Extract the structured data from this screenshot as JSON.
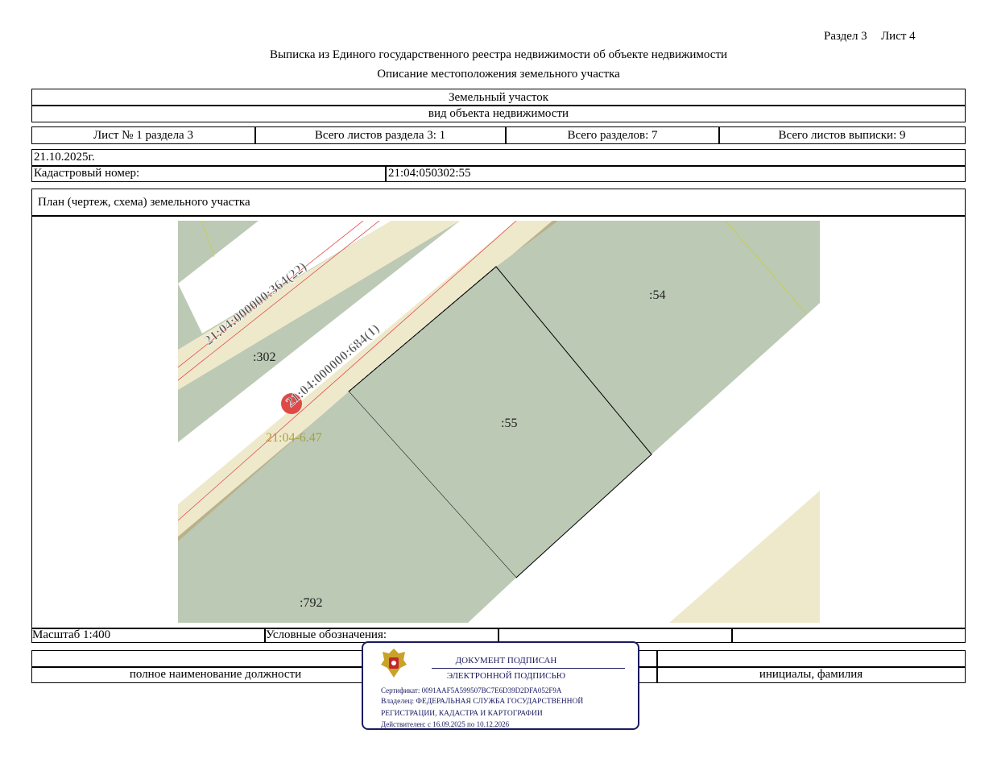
{
  "header": {
    "section": "Раздел 3",
    "sheet": "Лист 4",
    "title": "Выписка из Единого государственного реестра недвижимости об объекте недвижимости",
    "subtitle": "Описание местоположения земельного участка"
  },
  "object": {
    "type": "Земельный участок",
    "type_caption": "вид объекта недвижимости"
  },
  "sheets": {
    "sheet_num": "Лист № 1 раздела 3",
    "total_section_sheets": "Всего листов раздела 3: 1",
    "total_sections": "Всего разделов: 7",
    "total_extract_sheets": "Всего листов выписки: 9"
  },
  "info": {
    "date": "21.10.2025г.",
    "cadastral_label": "Кадастровый номер:",
    "cadastral_value": "21:04:050302:55"
  },
  "plan": {
    "title": "План (чертеж, схема) земельного участка",
    "labels": {
      "road1": "21:04:000000:364(22)",
      "road2": "21:04:000000:684(1)",
      "p302": ":302",
      "p54": ":54",
      "p55": ":55",
      "p792": ":792",
      "quarter": "21:04-6.47"
    },
    "colors": {
      "parcel": "#bcc9b4",
      "road": "#efe9cc",
      "boundary_red": "#e05050",
      "quarter_text": "#a8a040"
    }
  },
  "footer": {
    "scale": "Масштаб 1:400",
    "legend": "Условные обозначения:",
    "position_caption": "полное наименование должности",
    "name_caption": "инициалы, фамилия"
  },
  "signature": {
    "line1": "ДОКУМЕНТ ПОДПИСАН",
    "line2": "ЭЛЕКТРОННОЙ ПОДПИСЬЮ",
    "certificate": "Сертификат: 0091AAF5A599507BC7E6D39D2DFA052F9A",
    "owner1": "Владелец: ФЕДЕРАЛЬНАЯ СЛУЖБА ГОСУДАРСТВЕННОЙ",
    "owner2": "РЕГИСТРАЦИИ, КАДАСТРА И КАРТОГРАФИИ",
    "valid": "Действителен: с 16.09.2025 по 10.12.2026",
    "emblem_icon": "coat-of-arms-icon"
  }
}
